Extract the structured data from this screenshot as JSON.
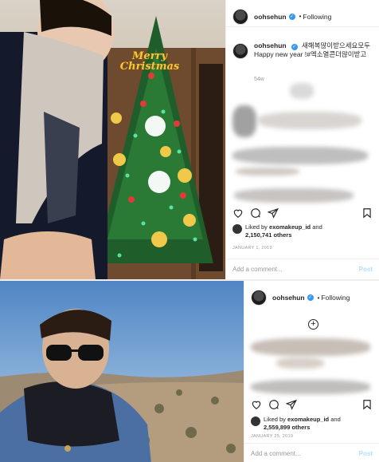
{
  "post1": {
    "photo_sign_line1": "Merry",
    "photo_sign_line2": "Christmas",
    "username": "oohsehun",
    "follow_label": "Following",
    "caption_username": "oohsehun",
    "caption_text": "새해복많이받으세요모두 Happy new year !#엑소열콘더많이받고",
    "time_ago": "54w",
    "liked_by_prefix": "Liked by",
    "liked_by_user": "exomakeup_id",
    "liked_by_and": "and",
    "likes_count": "2,150,741 others",
    "date": "JANUARY 1, 2019",
    "comment_placeholder": "Add a comment...",
    "post_label": "Post"
  },
  "post2": {
    "username": "oohsehun",
    "follow_label": "Following",
    "liked_by_prefix": "Liked by",
    "liked_by_user": "exomakeup_id",
    "liked_by_and": "and",
    "likes_count": "2,559,899 others",
    "date": "JANUARY 25, 2019",
    "comment_placeholder": "Add a comment...",
    "post_label": "Post"
  },
  "colors": {
    "verified": "#3897f0",
    "post_button": "#b2dffc",
    "muted": "#999999",
    "text": "#262626"
  },
  "icons": [
    "heart-icon",
    "comment-icon",
    "share-icon",
    "bookmark-icon",
    "verified-icon",
    "add-icon"
  ]
}
